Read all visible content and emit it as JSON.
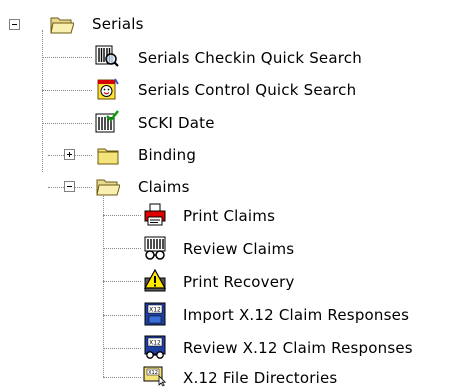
{
  "tree": {
    "serials": {
      "label": "Serials",
      "children": {
        "checkin_quick_search": "Serials Checkin Quick Search",
        "control_quick_search": "Serials Control Quick Search",
        "scki_date": "SCKI Date",
        "binding": "Binding",
        "claims": {
          "label": "Claims",
          "children": {
            "print_claims": "Print Claims",
            "review_claims": "Review Claims",
            "print_recovery": "Print Recovery",
            "import_x12": "Import X.12 Claim Responses",
            "review_x12": "Review X.12 Claim Responses",
            "x12_file_directories": "X.12 File Directories"
          }
        }
      }
    }
  },
  "icons": {
    "serials": "open-folder-icon",
    "checkin": "barcode-magnifier-icon",
    "control": "calendar-smiley-icon",
    "scki": "barcode-check-icon",
    "binding": "closed-folder-icon",
    "claims": "open-folder-icon",
    "print_claims": "printer-icon",
    "review_claims": "barcode-glasses-icon",
    "print_recovery": "warning-printer-icon",
    "import_x12": "x12-import-icon",
    "review_x12": "x12-review-icon",
    "x12_dirs": "x12-directory-icon"
  }
}
